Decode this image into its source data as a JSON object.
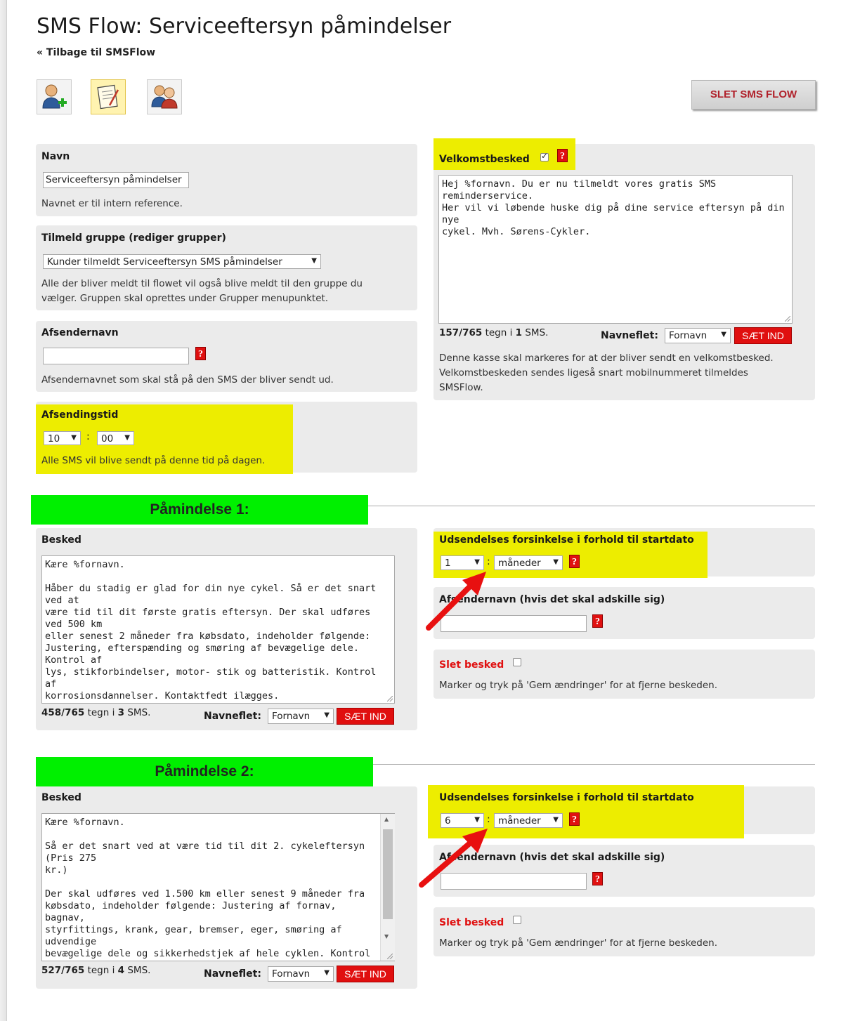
{
  "page": {
    "title": "SMS Flow: Serviceeftersyn påmindelser",
    "back_link": "« Tilbage til SMSFlow",
    "delete_flow_button": "SLET SMS FLOW"
  },
  "toolbar": {
    "icons": [
      "add-user-icon",
      "notepad-icon",
      "users-icon"
    ]
  },
  "navn": {
    "label": "Navn",
    "value": "Serviceeftersyn påmindelser",
    "help": "Navnet er til intern reference."
  },
  "gruppe": {
    "label": "Tilmeld gruppe (rediger grupper)",
    "selected": "Kunder tilmeldt Serviceeftersyn SMS påmindelser",
    "help_line1": "Alle der bliver meldt til flowet vil også blive meldt til den gruppe du",
    "help_line2": "vælger. Gruppen skal oprettes under Grupper menupunktet."
  },
  "afsender": {
    "label": "Afsendernavn",
    "value": "",
    "help": "Afsendernavnet som skal stå på den SMS der bliver sendt ud."
  },
  "afsendingstid": {
    "label": "Afsendingstid",
    "hour": "10",
    "separator": ":",
    "minute": "00",
    "help": "Alle SMS vil blive sendt på denne tid på dagen."
  },
  "velkomst": {
    "label": "Velkomstbesked",
    "checked": true,
    "message": "Hej %fornavn. Du er nu tilmeldt vores gratis SMS reminderservice.\nHer vil vi løbende huske dig på dine service eftersyn på din nye\ncykel. Mvh. Sørens-Cykler.",
    "count": "157/765",
    "count_mid": " tegn i ",
    "sms_count": "1",
    "sms_suffix": " SMS.",
    "navneflet_label": "Navneflet:",
    "navneflet_value": "Fornavn",
    "insert_button": "SÆT IND",
    "help_line1": "Denne kasse skal markeres for at der bliver sendt en velkomstbesked.",
    "help_line2": "Velkomstbeskeden sendes ligeså snart mobilnummeret tilmeldes",
    "help_line3": "SMSFlow."
  },
  "reminders": [
    {
      "heading": "Påmindelse 1:",
      "besked_label": "Besked",
      "message": "Kære %fornavn.\n\nHåber du stadig er glad for din nye cykel. Så er det snart ved at\nvære tid til dit første gratis eftersyn. Der skal udføres ved 500 km\neller senest 2 måneder fra købsdato, indeholder følgende:\nJustering, efterspænding og smøring af bevægelige dele. Kontrol af\nlys, stikforbindelser, motor- stik og batteristik. Kontrol af\nkorrosionsdannelser. Kontaktfedt ilægges.\nMvh. Sørens Cykler.\n:",
      "count": "458/765",
      "count_mid": " tegn i ",
      "sms_count": "3",
      "sms_suffix": " SMS.",
      "navneflet_label": "Navneflet:",
      "navneflet_value": "Fornavn",
      "insert_button": "SÆT IND",
      "delay_label": "Udsendelses forsinkelse i forhold til startdato",
      "delay_value": "1",
      "delay_sep": ":",
      "delay_unit": "måneder",
      "sender_label": "Afsendernavn (hvis det skal adskille sig)",
      "sender_value": "",
      "delete_label": "Slet besked",
      "delete_help": "Marker og tryk på 'Gem ændringer' for at fjerne beskeden."
    },
    {
      "heading": "Påmindelse 2:",
      "besked_label": "Besked",
      "message": "Kære %fornavn.\n\nSå er det snart ved at være tid til dit 2. cykeleftersyn (Pris 275\nkr.)\n\nDer skal udføres ved 1.500 km eller senest 9 måneder fra\nkøbsdato, indeholder følgende: Justering af fornav, bagnav,\nstyrfittings, krank, gear, bremser, eger, smøring af udvendige\nbevægelige dele og sikkerhedstjek af hele cyklen. Kontrol af lys,\nstikforbindelser, motorkontrol, motorstik og batteristik. Kontrol\naf korrosionsdannelser. Kontaktfedt ilægges.",
      "count": "527/765",
      "count_mid": " tegn i ",
      "sms_count": "4",
      "sms_suffix": " SMS.",
      "navneflet_label": "Navneflet:",
      "navneflet_value": "Fornavn",
      "insert_button": "SÆT IND",
      "delay_label": "Udsendelses forsinkelse i forhold til startdato",
      "delay_value": "6",
      "delay_sep": ":",
      "delay_unit": "måneder",
      "sender_label": "Afsendernavn (hvis det skal adskille sig)",
      "sender_value": "",
      "delete_label": "Slet besked",
      "delete_help": "Marker og tryk på 'Gem ændringer' for at fjerne beskeden."
    }
  ],
  "colors": {
    "highlight": "#eded00",
    "green_heading": "#00f000",
    "red_button": "#e00f0f",
    "panel": "#ebebeb"
  }
}
